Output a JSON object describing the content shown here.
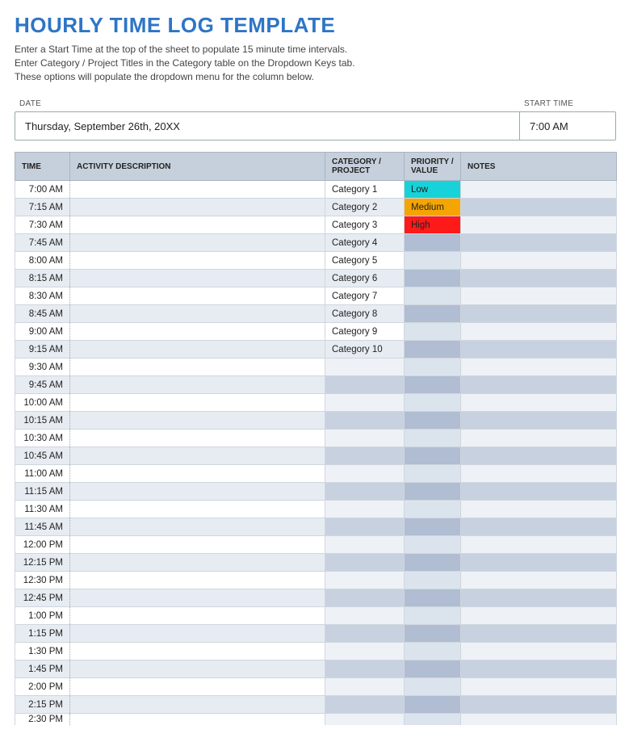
{
  "title": "HOURLY TIME LOG TEMPLATE",
  "instructions": [
    "Enter a Start Time at the top of the sheet to populate 15 minute time intervals.",
    "Enter Category / Project Titles in the Category table on the Dropdown Keys tab.",
    "These options will populate the dropdown menu for the column below."
  ],
  "fields": {
    "date_label": "DATE",
    "date_value": "Thursday, September 26th, 20XX",
    "start_label": "START TIME",
    "start_value": "7:00 AM"
  },
  "headers": {
    "time": "TIME",
    "activity": "ACTIVITY DESCRIPTION",
    "category": "CATEGORY / PROJECT",
    "priority": "PRIORITY / VALUE",
    "notes": "NOTES"
  },
  "rows": [
    {
      "time": "7:00 AM",
      "activity": "",
      "category": "Category 1",
      "priority": "Low",
      "notes": ""
    },
    {
      "time": "7:15 AM",
      "activity": "",
      "category": "Category 2",
      "priority": "Medium",
      "notes": ""
    },
    {
      "time": "7:30 AM",
      "activity": "",
      "category": "Category 3",
      "priority": "High",
      "notes": ""
    },
    {
      "time": "7:45 AM",
      "activity": "",
      "category": "Category 4",
      "priority": "",
      "notes": ""
    },
    {
      "time": "8:00 AM",
      "activity": "",
      "category": "Category 5",
      "priority": "",
      "notes": ""
    },
    {
      "time": "8:15 AM",
      "activity": "",
      "category": "Category 6",
      "priority": "",
      "notes": ""
    },
    {
      "time": "8:30 AM",
      "activity": "",
      "category": "Category 7",
      "priority": "",
      "notes": ""
    },
    {
      "time": "8:45 AM",
      "activity": "",
      "category": "Category 8",
      "priority": "",
      "notes": ""
    },
    {
      "time": "9:00 AM",
      "activity": "",
      "category": "Category 9",
      "priority": "",
      "notes": ""
    },
    {
      "time": "9:15 AM",
      "activity": "",
      "category": "Category 10",
      "priority": "",
      "notes": ""
    },
    {
      "time": "9:30 AM",
      "activity": "",
      "category": "",
      "priority": "",
      "notes": ""
    },
    {
      "time": "9:45 AM",
      "activity": "",
      "category": "",
      "priority": "",
      "notes": ""
    },
    {
      "time": "10:00 AM",
      "activity": "",
      "category": "",
      "priority": "",
      "notes": ""
    },
    {
      "time": "10:15 AM",
      "activity": "",
      "category": "",
      "priority": "",
      "notes": ""
    },
    {
      "time": "10:30 AM",
      "activity": "",
      "category": "",
      "priority": "",
      "notes": ""
    },
    {
      "time": "10:45 AM",
      "activity": "",
      "category": "",
      "priority": "",
      "notes": ""
    },
    {
      "time": "11:00 AM",
      "activity": "",
      "category": "",
      "priority": "",
      "notes": ""
    },
    {
      "time": "11:15 AM",
      "activity": "",
      "category": "",
      "priority": "",
      "notes": ""
    },
    {
      "time": "11:30 AM",
      "activity": "",
      "category": "",
      "priority": "",
      "notes": ""
    },
    {
      "time": "11:45 AM",
      "activity": "",
      "category": "",
      "priority": "",
      "notes": ""
    },
    {
      "time": "12:00 PM",
      "activity": "",
      "category": "",
      "priority": "",
      "notes": ""
    },
    {
      "time": "12:15 PM",
      "activity": "",
      "category": "",
      "priority": "",
      "notes": ""
    },
    {
      "time": "12:30 PM",
      "activity": "",
      "category": "",
      "priority": "",
      "notes": ""
    },
    {
      "time": "12:45 PM",
      "activity": "",
      "category": "",
      "priority": "",
      "notes": ""
    },
    {
      "time": "1:00 PM",
      "activity": "",
      "category": "",
      "priority": "",
      "notes": ""
    },
    {
      "time": "1:15 PM",
      "activity": "",
      "category": "",
      "priority": "",
      "notes": ""
    },
    {
      "time": "1:30 PM",
      "activity": "",
      "category": "",
      "priority": "",
      "notes": ""
    },
    {
      "time": "1:45 PM",
      "activity": "",
      "category": "",
      "priority": "",
      "notes": ""
    },
    {
      "time": "2:00 PM",
      "activity": "",
      "category": "",
      "priority": "",
      "notes": ""
    },
    {
      "time": "2:15 PM",
      "activity": "",
      "category": "",
      "priority": "",
      "notes": ""
    },
    {
      "time": "2:30 PM",
      "activity": "",
      "category": "",
      "priority": "",
      "notes": ""
    }
  ]
}
